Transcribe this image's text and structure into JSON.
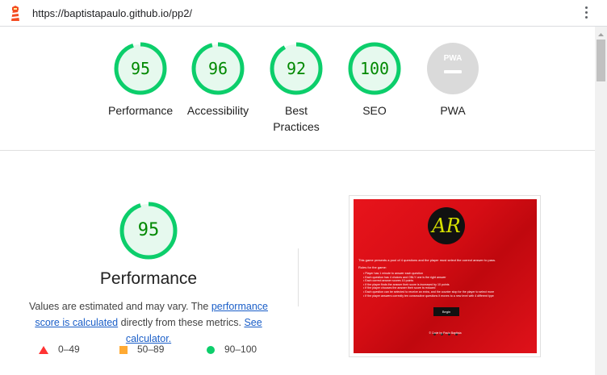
{
  "browser": {
    "url": "https://baptistapaulo.github.io/pp2/",
    "logo_icon": "lighthouse-icon",
    "menu_icon": "kebab-menu-icon"
  },
  "categories": [
    {
      "label": "Performance",
      "score": "95"
    },
    {
      "label": "Accessibility",
      "score": "96"
    },
    {
      "label": "Best Practices",
      "score": "92"
    },
    {
      "label": "SEO",
      "score": "100"
    },
    {
      "label": "PWA",
      "badge_text": "PWA"
    }
  ],
  "performance": {
    "score": "95",
    "title": "Performance",
    "note_prefix": "Values are estimated and may vary. The ",
    "score_link": "performance score is calculated",
    "note_middle": " directly from these metrics. ",
    "calc_link": "See calculator."
  },
  "legend": [
    {
      "range": "0–49",
      "color": "#ff3333",
      "shape": "triangle"
    },
    {
      "range": "50–89",
      "color": "#ffaa33",
      "shape": "square"
    },
    {
      "range": "90–100",
      "color": "#0cce6b",
      "shape": "circle"
    }
  ],
  "screenshot": {
    "logo_text": "AR",
    "intro": "This game presents a pool of 4 questions and the player must select the correct answer to pass.",
    "rules_title": "Rules for the game:",
    "rules": [
      "Player has 1 minute to answer each question",
      "Each question has 4 choices and ONLY one is the right answer",
      "Each correct answer scores 10 points",
      "If the player finds the answer their score is increased by 10 points",
      "If the player chooses the answer their score is reduced",
      "Each question can be selected to receive an extra, and the counter stop for the player to select more",
      "If the player answers correctly ten consecutive questions it moves to a new level with 4 different type"
    ],
    "begin_label": "Begin",
    "footer": "© Code by Paulo Baptista"
  },
  "colors": {
    "pass": "#0cce6b",
    "pass_bg": "#e6f9ee",
    "pass_text": "#008800",
    "average": "#ffaa33",
    "fail": "#ff3333",
    "link": "#1a5ec8",
    "pwa_gray": "#dadada"
  }
}
